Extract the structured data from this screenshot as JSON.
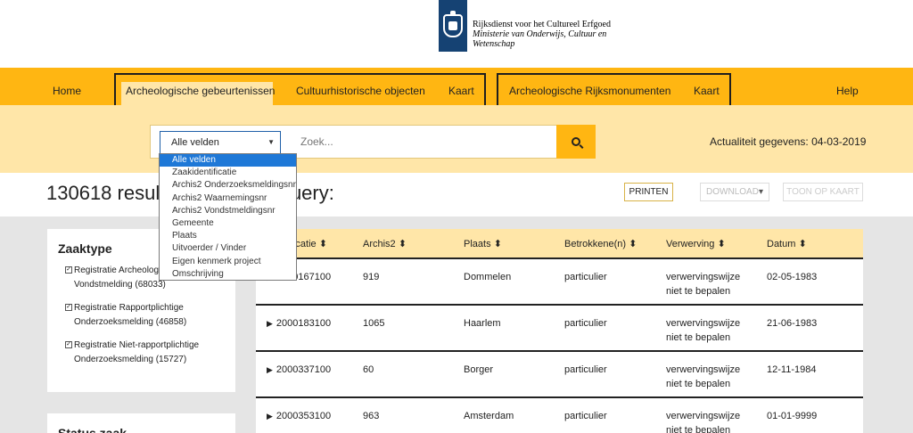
{
  "header": {
    "org_line1": "Rijksdienst voor het Cultureel Erfgoed",
    "org_line2": "Ministerie van Onderwijs, Cultuur en",
    "org_line3": "Wetenschap"
  },
  "nav": {
    "home": "Home",
    "arch_gebeurtenissen": "Archeologische gebeurtenissen",
    "cult_objecten": "Cultuurhistorische objecten",
    "kaart1": "Kaart",
    "arch_rijksmonumenten": "Archeologische Rijksmonumenten",
    "kaart2": "Kaart",
    "help": "Help"
  },
  "search": {
    "select_value": "Alle velden",
    "placeholder": "Zoek...",
    "actualiteit": "Actualiteit gegevens: 04-03-2019"
  },
  "dropdown": {
    "options": [
      "Alle velden",
      "Zaakidentificatie",
      "Archis2 Onderzoeksmeldingsnr",
      "Archis2 Waarnemingsnr",
      "Archis2 Vondstmeldingsnr",
      "Gemeente",
      "Plaats",
      "Uitvoerder / Vinder",
      "Eigen kenmerk project",
      "Omschrijving"
    ]
  },
  "results": {
    "title": "130618 results for internet query:",
    "print": "PRINTEN",
    "download": "DOWNLOAD",
    "toon": "TOON OP KAART"
  },
  "filter": {
    "title": "Zaaktype",
    "items": [
      {
        "line1": "Registratie Archeologische",
        "line2": "Vondstmelding (68033)"
      },
      {
        "line1": "Registratie Rapportplichtige",
        "line2": "Onderzoeksmelding (46858)"
      },
      {
        "line1": "Registratie Niet-rapportplichtige",
        "line2": "Onderzoeksmelding (15727)"
      }
    ],
    "title2": "Status zaak"
  },
  "table": {
    "headers": [
      "Identificatie",
      "Archis2",
      "Plaats",
      "Betrokkene(n)",
      "Verwerving",
      "Datum"
    ],
    "rows": [
      {
        "id": "2000167100",
        "archis2": "919",
        "plaats": "Dommelen",
        "betrokkenen": "particulier",
        "verwerving1": "verwervingswijze",
        "verwerving2": "niet te bepalen",
        "datum": "02-05-1983"
      },
      {
        "id": "2000183100",
        "archis2": "1065",
        "plaats": "Haarlem",
        "betrokkenen": "particulier",
        "verwerving1": "verwervingswijze",
        "verwerving2": "niet te bepalen",
        "datum": "21-06-1983"
      },
      {
        "id": "2000337100",
        "archis2": "60",
        "plaats": "Borger",
        "betrokkenen": "particulier",
        "verwerving1": "verwervingswijze",
        "verwerving2": "niet te bepalen",
        "datum": "12-11-1984"
      },
      {
        "id": "2000353100",
        "archis2": "963",
        "plaats": "Amsterdam",
        "betrokkenen": "particulier",
        "verwerving1": "verwervingswijze",
        "verwerving2": "niet te bepalen",
        "datum": "01-01-9999"
      }
    ]
  },
  "colors": {
    "brand_yellow": "#ffb612",
    "light_yellow": "#ffe6a8",
    "logo_blue": "#154273",
    "select_blue": "#1e78d7"
  }
}
